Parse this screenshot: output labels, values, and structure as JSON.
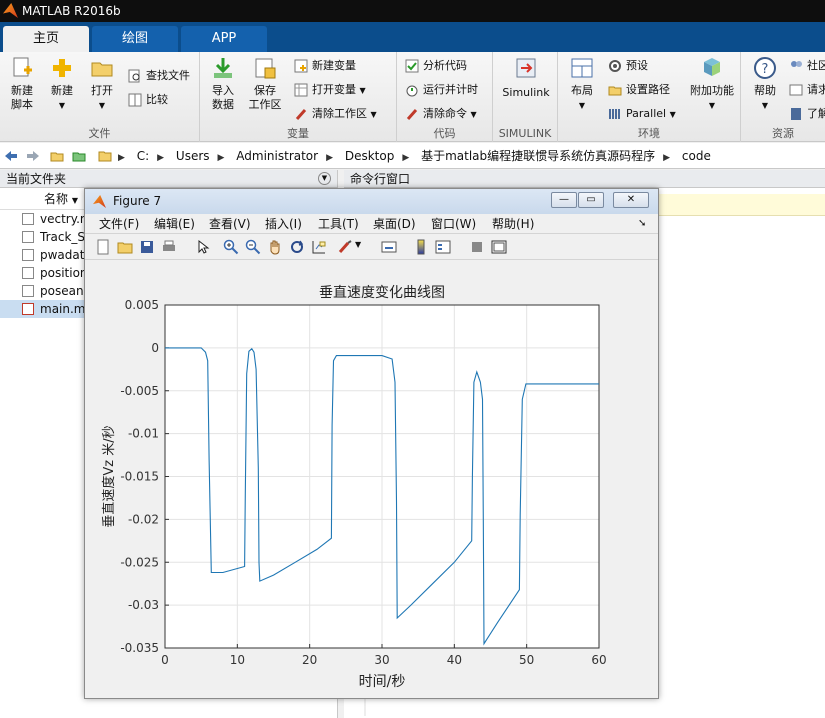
{
  "window": {
    "title": "MATLAB R2016b"
  },
  "tabs": [
    "主页",
    "绘图",
    "APP"
  ],
  "ribbon": {
    "file": {
      "caption": "文件",
      "new_script": "新建\n脚本",
      "new": "新建",
      "open": "打开",
      "find_files": "查找文件",
      "compare": "比较"
    },
    "variable": {
      "caption": "变量",
      "import": "导入\n数据",
      "save_ws": "保存\n工作区",
      "new_var": "新建变量",
      "open_var": "打开变量",
      "clear_ws": "清除工作区"
    },
    "code": {
      "caption": "代码",
      "analyze": "分析代码",
      "run_time": "运行并计时",
      "clear_cmd": "清除命令"
    },
    "simulink": {
      "caption": "SIMULINK",
      "label": "Simulink"
    },
    "env": {
      "caption": "环境",
      "layout": "布局",
      "prefs": "预设",
      "set_path": "设置路径",
      "parallel": "Parallel",
      "addons": "附加功能"
    },
    "resources": {
      "caption": "资源",
      "help": "帮助",
      "community": "社区",
      "request": "请求",
      "learn": "了解"
    }
  },
  "address": {
    "parts": [
      "C:",
      "Users",
      "Administrator",
      "Desktop",
      "基于matlab编程捷联惯导系统仿真源码程序",
      "code"
    ]
  },
  "left_panel": {
    "title": "当前文件夹",
    "col_name": "名称",
    "files": [
      {
        "name": "vectry.m",
        "selected": false
      },
      {
        "name": "Track_S",
        "selected": false
      },
      {
        "name": "pwadat",
        "selected": false
      },
      {
        "name": "position",
        "selected": false
      },
      {
        "name": "posean",
        "selected": false
      },
      {
        "name": "main.m",
        "selected": true
      }
    ]
  },
  "right_panel": {
    "title": "命令行窗口"
  },
  "figure": {
    "title": "Figure 7",
    "menu": [
      "文件(F)",
      "编辑(E)",
      "查看(V)",
      "插入(I)",
      "工具(T)",
      "桌面(D)",
      "窗口(W)",
      "帮助(H)"
    ]
  },
  "colors": {
    "line": "#1f77b4",
    "ribbon_tabbar": "#0b4d8c"
  },
  "chart_data": {
    "type": "line",
    "title": "垂直速度变化曲线图",
    "xlabel": "时间/秒",
    "ylabel": "垂直速度Vz 米/秒",
    "xlim": [
      0,
      60
    ],
    "ylim": [
      -0.035,
      0.005
    ],
    "xticks": [
      "0",
      "10",
      "20",
      "30",
      "40",
      "50",
      "60"
    ],
    "yticks": [
      "0.005",
      "0",
      "-0.005",
      "-0.01",
      "-0.015",
      "-0.02",
      "-0.025",
      "-0.03",
      "-0.035"
    ],
    "grid": true,
    "series": [
      {
        "x": [
          0,
          5,
          5.6,
          5.9,
          6.1,
          6.4,
          8,
          11,
          11.1,
          11.3,
          11.6,
          12,
          12.3,
          12.6,
          12.9,
          13,
          13.1,
          15,
          18,
          21,
          23,
          23.1,
          23.3,
          23.7,
          25,
          30,
          31.4,
          31.8,
          32,
          32.1,
          34,
          37,
          40,
          42.4,
          42.5,
          42.7,
          43.1,
          43.6,
          43.9,
          44,
          44.1,
          46,
          49,
          49.1,
          49.4,
          49.9,
          52,
          60
        ],
        "y": [
          0,
          0,
          -0.0005,
          -0.0015,
          -0.013,
          -0.0262,
          -0.0262,
          -0.0255,
          -0.017,
          -0.003,
          -0.0004,
          -0.0001,
          -0.0005,
          -0.0025,
          -0.014,
          -0.025,
          -0.0272,
          -0.0265,
          -0.025,
          -0.0235,
          -0.0222,
          -0.009,
          -0.0015,
          -0.0009,
          -0.0009,
          -0.0009,
          -0.0013,
          -0.004,
          -0.018,
          -0.0315,
          -0.03,
          -0.0275,
          -0.025,
          -0.0225,
          -0.015,
          -0.004,
          -0.0028,
          -0.004,
          -0.006,
          -0.02,
          -0.0345,
          -0.032,
          -0.0282,
          -0.0195,
          -0.006,
          -0.0042,
          -0.0042,
          -0.0042
        ]
      }
    ]
  }
}
